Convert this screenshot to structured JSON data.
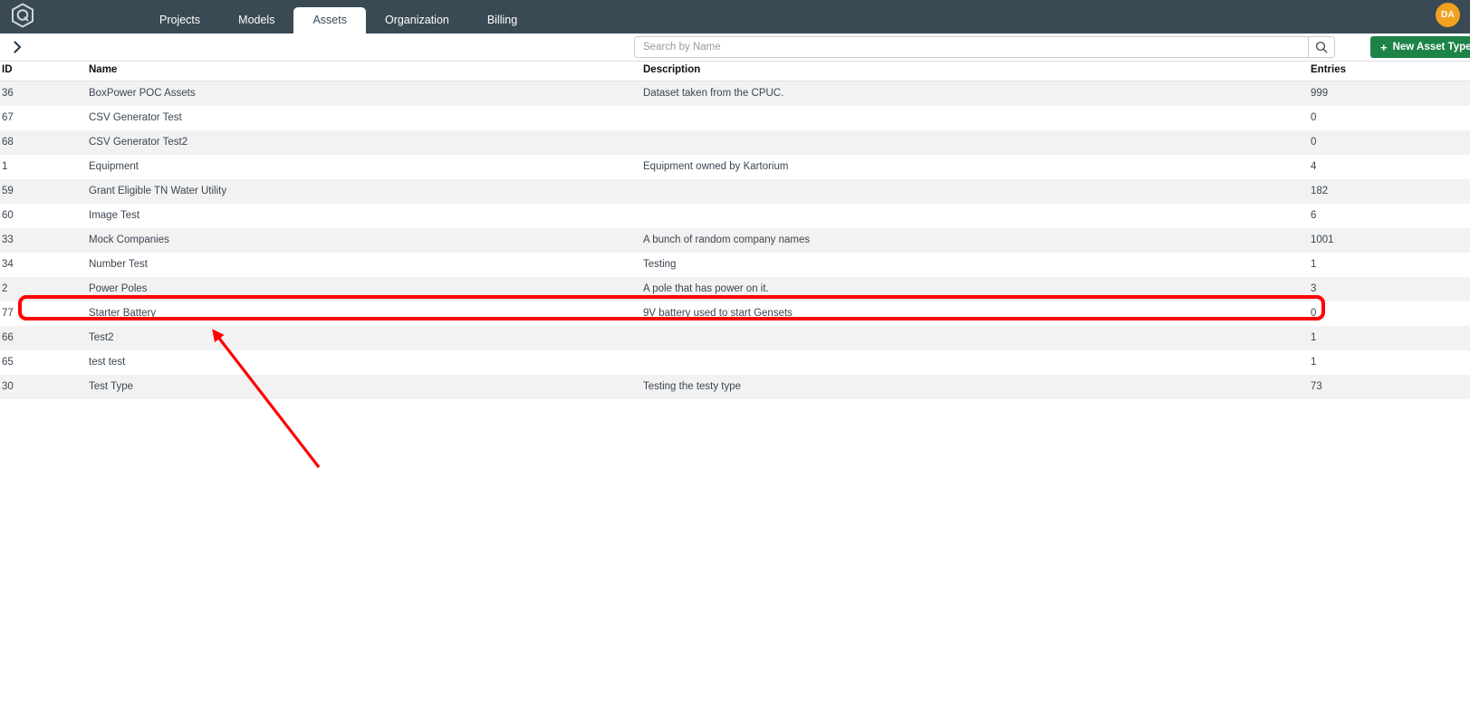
{
  "nav": {
    "logo_icon": "hexagon-q-logo-icon",
    "tabs": [
      {
        "label": "Projects",
        "active": false
      },
      {
        "label": "Models",
        "active": false
      },
      {
        "label": "Assets",
        "active": true
      },
      {
        "label": "Organization",
        "active": false
      },
      {
        "label": "Billing",
        "active": false
      }
    ],
    "avatar_initials": "DA",
    "avatar_color": "#f0a11e"
  },
  "toolbar": {
    "sidebar_toggle_icon": "chevron-right-icon",
    "search_placeholder": "Search by Name",
    "search_value": "",
    "search_icon": "search-icon",
    "new_asset_plus": "+",
    "new_asset_label": "New Asset Type",
    "new_asset_color": "#1d8348"
  },
  "table": {
    "columns": [
      "ID",
      "Name",
      "Description",
      "Entries"
    ],
    "rows": [
      {
        "id": "36",
        "name": "BoxPower POC Assets",
        "description": "Dataset taken from the CPUC.",
        "entries": "999"
      },
      {
        "id": "67",
        "name": "CSV Generator Test",
        "description": "",
        "entries": "0"
      },
      {
        "id": "68",
        "name": "CSV Generator Test2",
        "description": "",
        "entries": "0"
      },
      {
        "id": "1",
        "name": "Equipment",
        "description": "Equipment owned by Kartorium",
        "entries": "4"
      },
      {
        "id": "59",
        "name": "Grant Eligible TN Water Utility",
        "description": "",
        "entries": "182"
      },
      {
        "id": "60",
        "name": "Image Test",
        "description": "",
        "entries": "6"
      },
      {
        "id": "33",
        "name": "Mock Companies",
        "description": "A bunch of random company names",
        "entries": "1001"
      },
      {
        "id": "34",
        "name": "Number Test",
        "description": "Testing",
        "entries": "1"
      },
      {
        "id": "2",
        "name": "Power Poles",
        "description": "A pole that has power on it.",
        "entries": "3"
      },
      {
        "id": "77",
        "name": "Starter Battery",
        "description": "9V battery used to start Gensets",
        "entries": "0"
      },
      {
        "id": "66",
        "name": "Test2",
        "description": "",
        "entries": "1"
      },
      {
        "id": "65",
        "name": "test test",
        "description": "",
        "entries": "1"
      },
      {
        "id": "30",
        "name": "Test Type",
        "description": "Testing the testy type",
        "entries": "73"
      }
    ]
  },
  "annotation": {
    "highlight_color": "#ff0000",
    "arrow_color": "#ff0000",
    "highlighted_row_name": "Starter Battery"
  }
}
